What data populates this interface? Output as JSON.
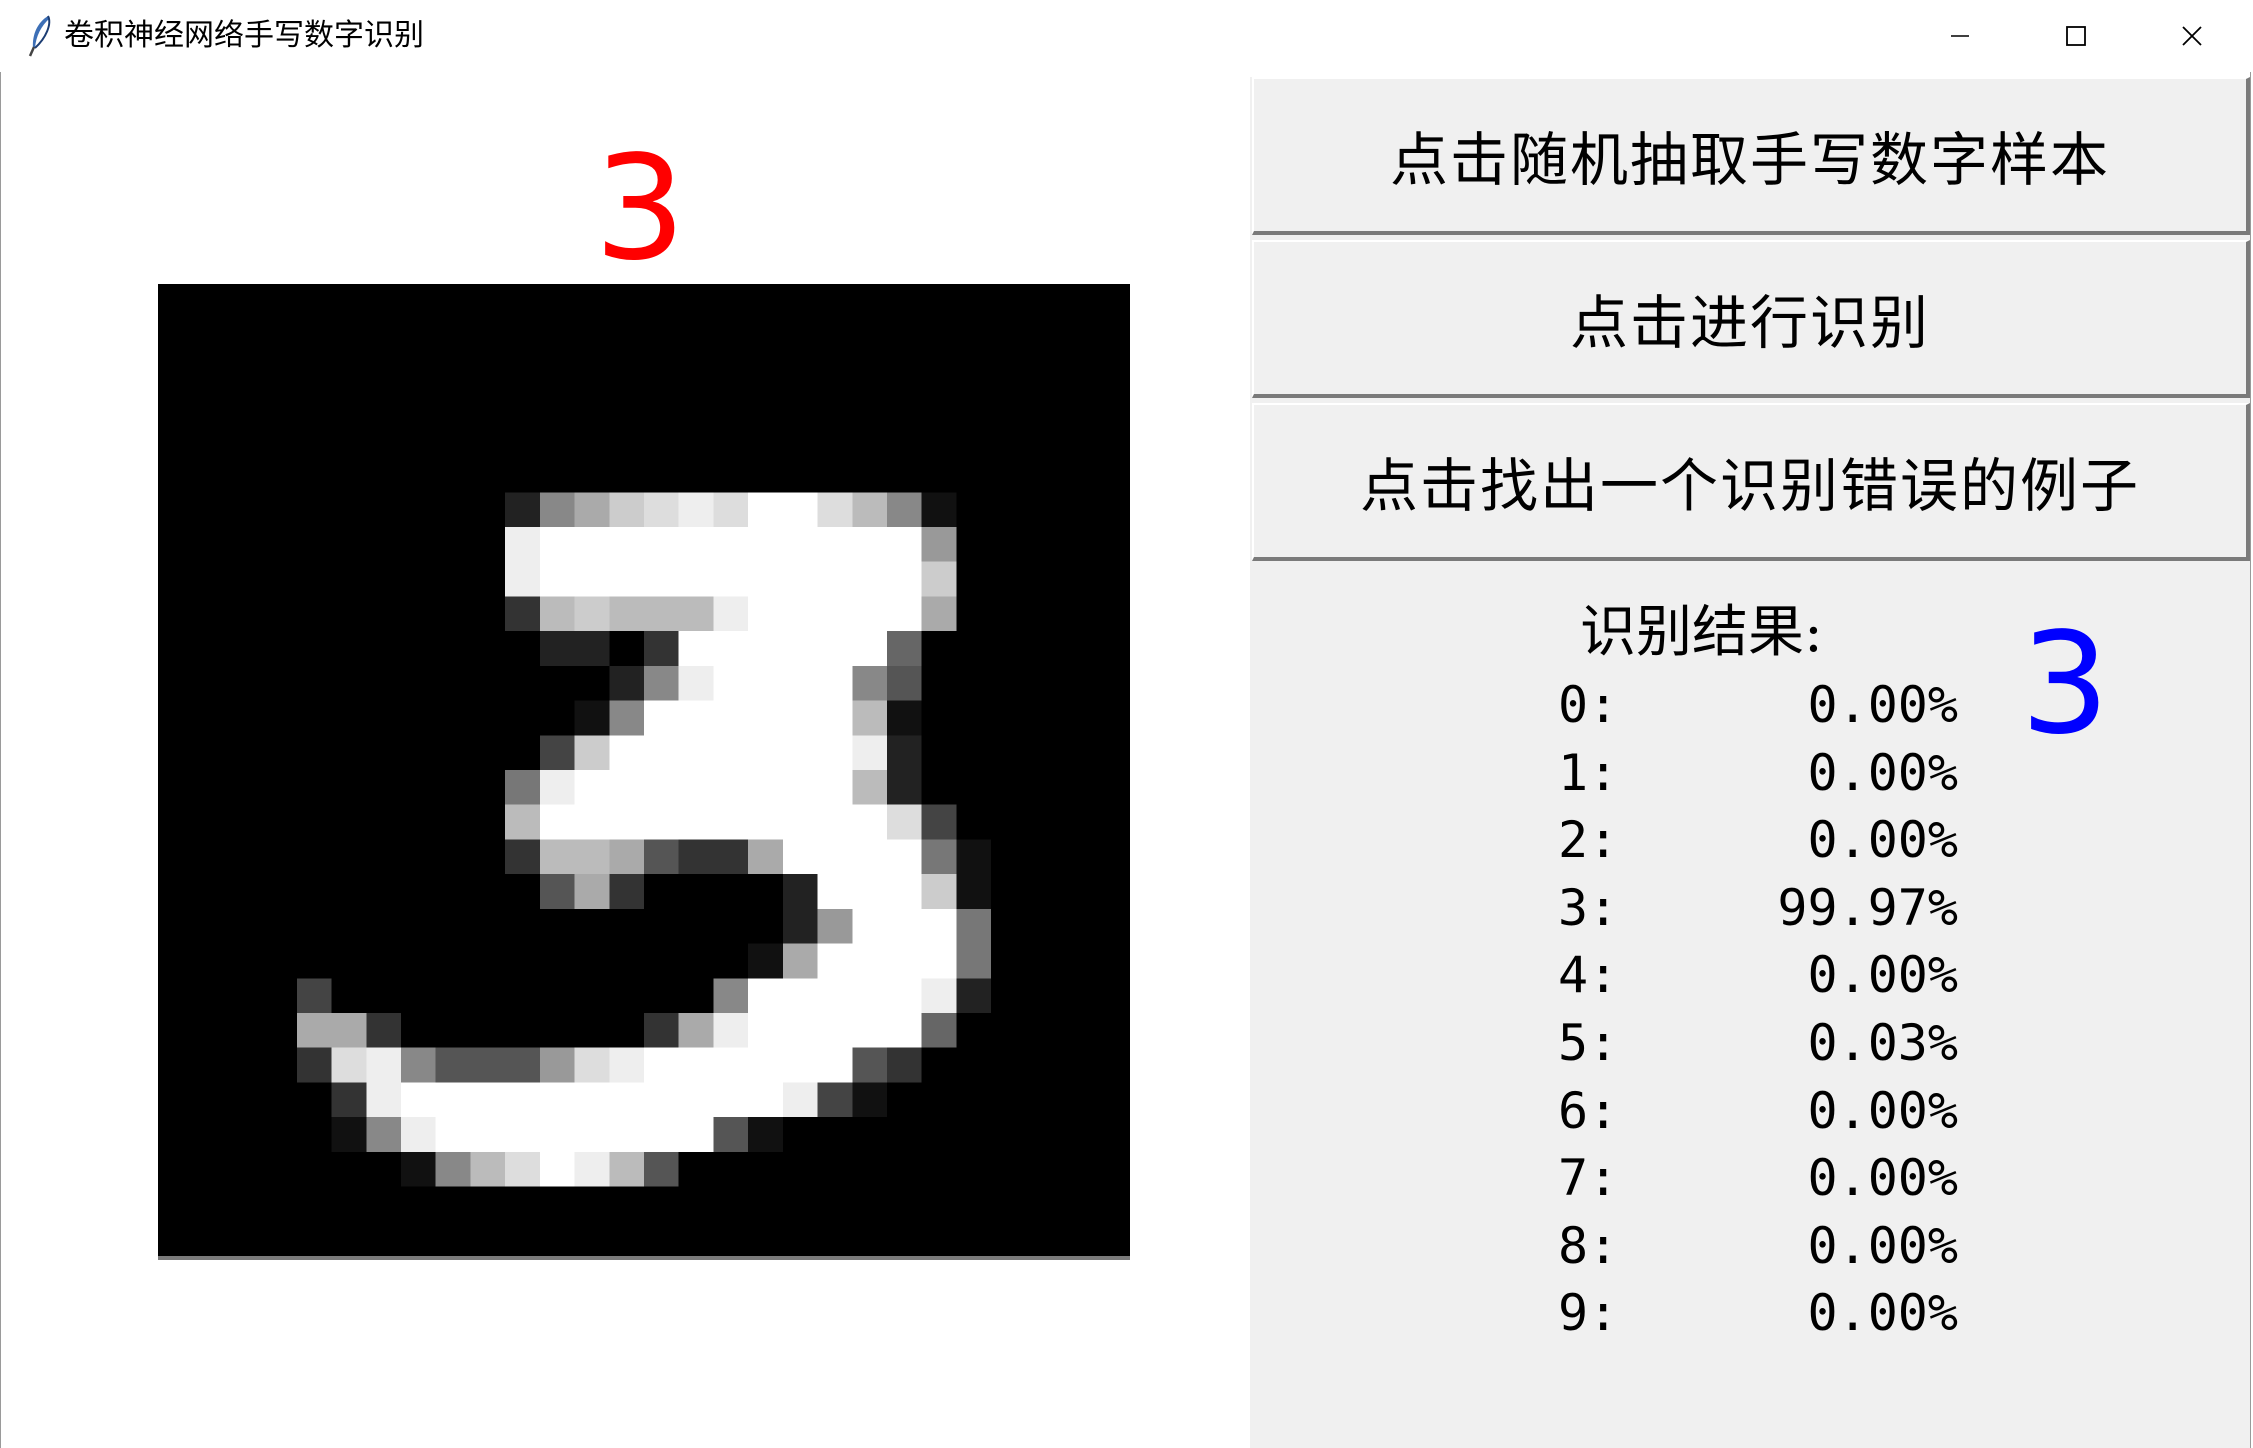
{
  "window": {
    "title": "卷积神经网络手写数字识别",
    "controls": [
      "minimize",
      "maximize",
      "close"
    ]
  },
  "sample": {
    "true_label": "3",
    "image_kind": "MNIST 28x28 grayscale handwritten digit",
    "pixel_rows": [
      "............................",
      "............................",
      "............................",
      "............................",
      "............................",
      "............................",
      "..........28ACDEDFFDB81.....",
      "..........EFFFFFFFFFFF9.....",
      "..........EFFFFFFFFFFFC.....",
      "..........3BCBBBEFFFFFA.....",
      "...........22.3FFFFFF6.....",
      ".............28EFFFF85......",
      "............18FFFFFFB1......",
      "...........4CFFFFFFFE2......",
      "..........7EFFFFFFFFB2......",
      "..........BFFFFFFFFFFD4.....",
      "..........3BBA533AFFFF71....",
      "...........5A3....2FFFC1....",
      "..................29FFF7....",
      ".................1AFFFF7....",
      "....4...........8FFFFFE2....",
      "....AA3.......3AEFFFFF6.....",
      "....3DE85559DEFFFFFF53......",
      ".....3EFFFFFFFFFFFE41.......",
      ".....18EFFFFFFFF51..........",
      ".......18BDFEB5.............",
      "............................",
      "............................"
    ]
  },
  "buttons": {
    "random_sample": "点击随机抽取手写数字样本",
    "recognize": "点击进行识别",
    "find_error": "点击找出一个识别错误的例子"
  },
  "result": {
    "title": "识别结果:",
    "predicted_digit": "3",
    "probabilities": [
      {
        "digit": "0:",
        "value": "0.00%"
      },
      {
        "digit": "1:",
        "value": "0.00%"
      },
      {
        "digit": "2:",
        "value": "0.00%"
      },
      {
        "digit": "3:",
        "value": "99.97%"
      },
      {
        "digit": "4:",
        "value": "0.00%"
      },
      {
        "digit": "5:",
        "value": "0.03%"
      },
      {
        "digit": "6:",
        "value": "0.00%"
      },
      {
        "digit": "7:",
        "value": "0.00%"
      },
      {
        "digit": "8:",
        "value": "0.00%"
      },
      {
        "digit": "9:",
        "value": "0.00%"
      }
    ]
  },
  "colors": {
    "true_label": "#ff0000",
    "predicted_digit": "#0000ff",
    "panel_background": "#f0f0f0",
    "canvas_background": "#000000"
  }
}
